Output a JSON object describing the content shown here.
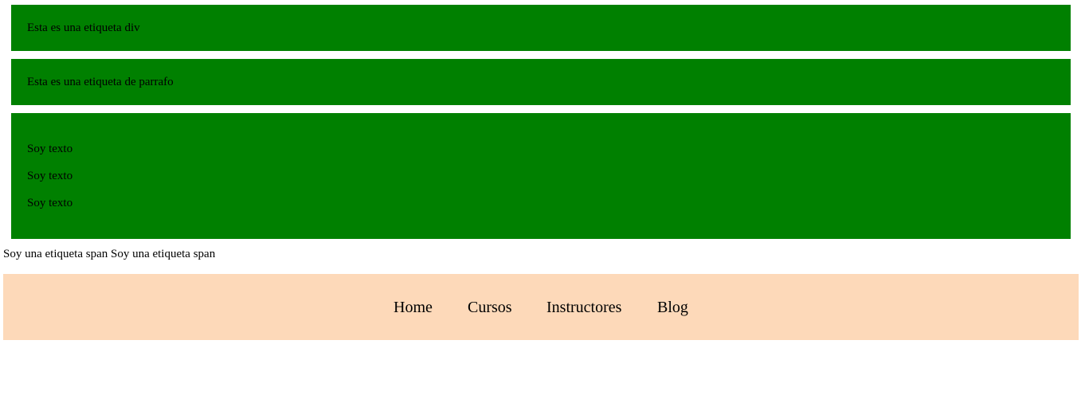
{
  "div_box": {
    "text": "Esta es una etiqueta div"
  },
  "paragraph_box": {
    "text": "Esta es una etiqueta de parrafo"
  },
  "text_box": {
    "lines": [
      "Soy texto",
      "Soy texto",
      "Soy texto"
    ]
  },
  "spans": {
    "text": "Soy una etiqueta span Soy una etiqueta span"
  },
  "nav": {
    "items": [
      {
        "label": "Home"
      },
      {
        "label": "Cursos"
      },
      {
        "label": "Instructores"
      },
      {
        "label": "Blog"
      }
    ]
  },
  "colors": {
    "box_background": "#008000",
    "nav_background": "#fdd9b9"
  }
}
